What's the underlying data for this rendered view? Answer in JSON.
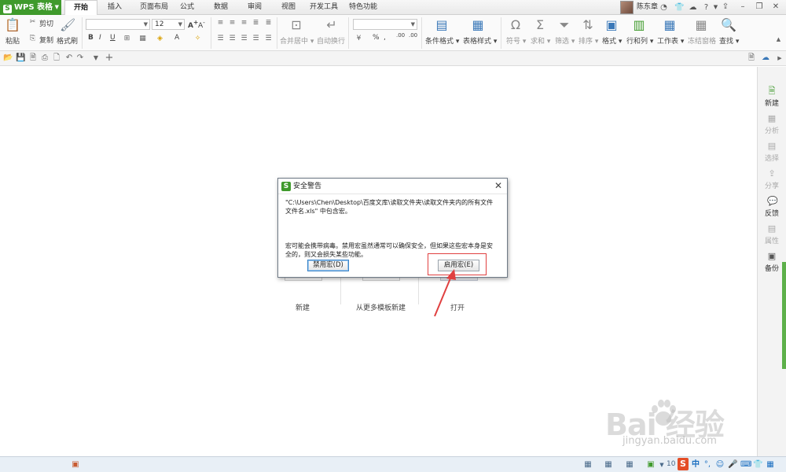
{
  "app": {
    "name": "WPS 表格",
    "logo_glyph": "S"
  },
  "tabs": [
    {
      "label": "开始",
      "active": true
    },
    {
      "label": "插入",
      "active": false
    },
    {
      "label": "页面布局",
      "active": false
    },
    {
      "label": "公式",
      "active": false
    },
    {
      "label": "数据",
      "active": false
    },
    {
      "label": "审阅",
      "active": false
    },
    {
      "label": "视图",
      "active": false
    },
    {
      "label": "开发工具",
      "active": false
    },
    {
      "label": "特色功能",
      "active": false
    }
  ],
  "user": {
    "name": "陈东章"
  },
  "ribbon": {
    "paste": "粘贴",
    "cut": "剪切",
    "copy": "复制",
    "format_painter": "格式刷",
    "font_size": "12",
    "bold": "B",
    "italic": "I",
    "underline": "U",
    "merge_center": "合并居中",
    "wrap_text": "自动换行",
    "percent": "%",
    "thousands": ",",
    "inc_decimal": ".00",
    "dec_decimal": ".00",
    "cond_format": "条件格式",
    "table_style": "表格样式",
    "symbol": "符号",
    "sum": "求和",
    "filter": "筛选",
    "sort": "排序",
    "format": "格式",
    "row_col": "行和列",
    "worksheet": "工作表",
    "freeze": "冻结窗格",
    "find": "查找"
  },
  "start_page": {
    "new_label": "新建",
    "template_label": "从更多模板新建",
    "open_label": "打开"
  },
  "right_panel": [
    {
      "label": "新建",
      "enabled": true
    },
    {
      "label": "分析",
      "enabled": false
    },
    {
      "label": "选择",
      "enabled": false
    },
    {
      "label": "分享",
      "enabled": false
    },
    {
      "label": "反馈",
      "enabled": true
    },
    {
      "label": "属性",
      "enabled": false
    },
    {
      "label": "备份",
      "enabled": true
    }
  ],
  "dialog": {
    "title": "安全警告",
    "line1": "\"C:\\Users\\Chen\\Desktop\\百度文库\\读取文件夹\\读取文件夹内的所有文件",
    "line2": "文件名.xls\" 中包含宏。",
    "line3": "宏可能会携带病毒。禁用宏虽然通常可以确保安全，但如果这些宏本身是安",
    "line4": "全的，则又会损失某些功能。",
    "disable_button": "禁用宏(D)",
    "enable_button": "启用宏(E)"
  },
  "statusbar": {
    "zoom": "10"
  },
  "watermark": {
    "text": "Bai  经验",
    "url": "jingyan.baidu.com"
  },
  "colors": {
    "brand_green": "#3f9a2c",
    "highlight_red": "#e04040",
    "focus_blue": "#3a84c8"
  }
}
